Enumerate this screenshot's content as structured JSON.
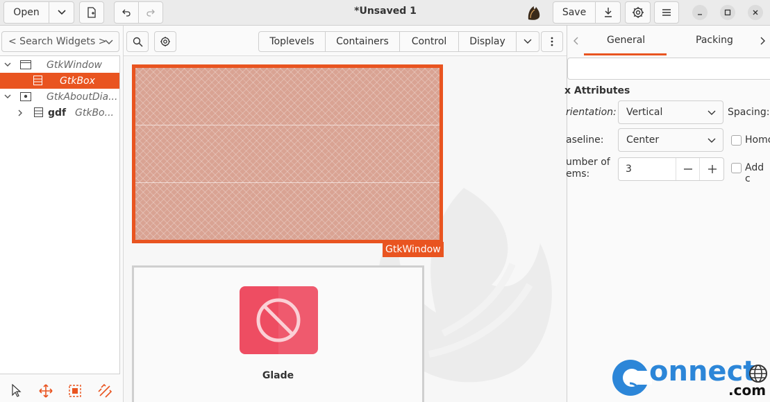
{
  "header": {
    "open_label": "Open",
    "title": "*Unsaved 1",
    "save_label": "Save"
  },
  "left": {
    "search_placeholder": "< Search Widgets >",
    "tree": [
      {
        "label": "GtkWindow",
        "selected": false
      },
      {
        "label": "GtkBox",
        "selected": true
      },
      {
        "label": "GtkAboutDia...",
        "selected": false
      },
      {
        "name": "gdf",
        "label": "GtkBo...",
        "selected": false
      }
    ]
  },
  "palette": {
    "tabs": [
      "Toplevels",
      "Containers",
      "Control",
      "Display"
    ]
  },
  "canvas": {
    "window_label": "GtkWindow",
    "about_title": "Glade"
  },
  "properties": {
    "tabs": [
      "General",
      "Packing"
    ],
    "section": "x Attributes",
    "orientation_label": "rientation:",
    "orientation_value": "Vertical",
    "spacing_label": "Spacing:",
    "baseline_label": "aseline:",
    "baseline_value": "Center",
    "homogeneous_label": "Homo",
    "items_label_1": "umber of",
    "items_label_2": "ems:",
    "items_value": "3",
    "add_label": "Add c"
  },
  "watermark": {
    "word": "onnect",
    "suffix": ".com"
  },
  "colors": {
    "accent": "#e95420",
    "glade_red": "#ee4d62",
    "logo_blue": "#2c86d8"
  }
}
